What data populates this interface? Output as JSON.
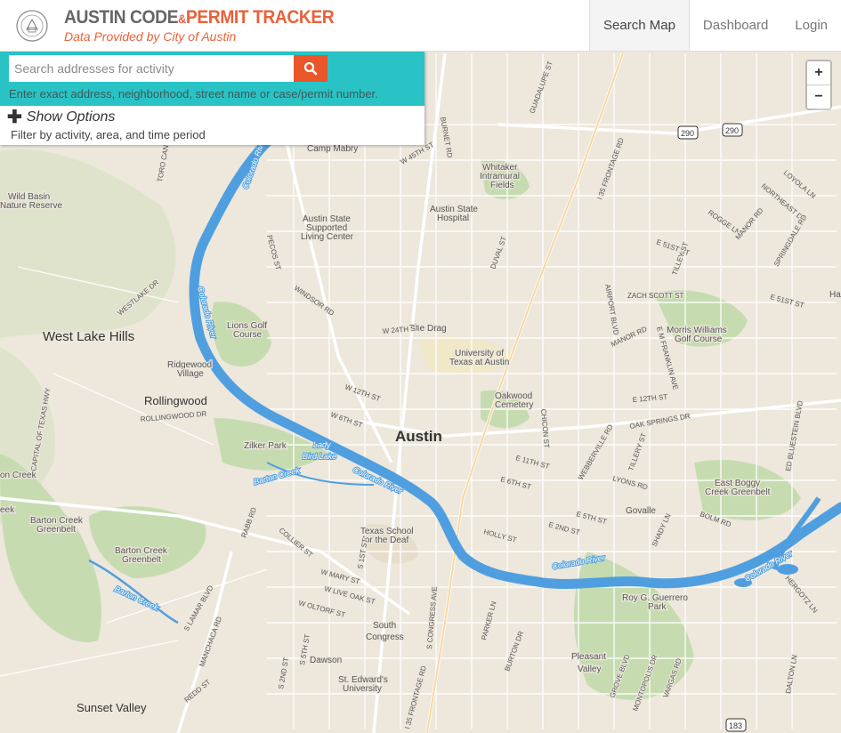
{
  "header": {
    "brand_part1": "AUSTIN CODE",
    "brand_amp": "&",
    "brand_part2": "PERMIT",
    "brand_part3": "TRACKER",
    "subtitle": "Data Provided by City of Austin",
    "nav": [
      "Search Map",
      "Dashboard",
      "Login"
    ]
  },
  "search": {
    "placeholder": "Search addresses for activity",
    "hint": "Enter exact address, neighborhood, street name or case/permit number.",
    "show_options": "Show Options",
    "options_sub": "Filter by activity, area, and time period"
  },
  "zoom": {
    "in": "+",
    "out": "−"
  },
  "colors": {
    "accent_teal": "#29c3c5",
    "accent_orange": "#e8562a",
    "water": "#4f9fe0",
    "park": "#c6dcb0",
    "land": "#ede7dc"
  },
  "map": {
    "cities": [
      {
        "name": "Austin"
      },
      {
        "name": "West Lake Hills"
      },
      {
        "name": "Rollingwood"
      },
      {
        "name": "Sunset Valley"
      }
    ],
    "places": [
      "Camp Mabry",
      "Whitaker",
      "Intramural",
      "Fields",
      "Wild Basin",
      "Nature Reserve",
      "Austin State",
      "Hospital",
      "Austin State",
      "Supported",
      "Living Center",
      "Lions Golf",
      "Course",
      "The Drag",
      "University of",
      "Texas at Austin",
      "Ridgewood",
      "Village",
      "Oakwood",
      "Cemetery",
      "Zilker Park",
      "Morris Williams",
      "Golf Course",
      "East Boggy",
      "Creek Greenbelt",
      "Govalle",
      "Barton Creek",
      "Greenbelt",
      "Barton Creek",
      "Greenbelt",
      "Texas School",
      "for the Deaf",
      "South",
      "Congress",
      "Dawson",
      "St. Edward's",
      "University",
      "Roy G. Guerrero",
      "Park",
      "Pleasant",
      "Valley",
      "on Creek",
      "eek",
      "Ha"
    ],
    "streets": [
      "GUADALUPE ST",
      "BURNET RD",
      "W 45TH ST",
      "I 35 FRONTAGE RD",
      "LOYOLA LN",
      "NORTHEAST DR",
      "ROGGE LN",
      "MANOR RD",
      "E 51ST ST",
      "TILLEY ST",
      "SPRINGDALE RD",
      "ZACH SCOTT ST",
      "E 51ST ST",
      "AIRPORT BLVD",
      "MANOR RD",
      "E M FRANKLIN AVE",
      "DUVAL ST",
      "PECOS ST",
      "WINDSOR RD",
      "WESTLAKE DR",
      "W 24TH ST",
      "W 12TH ST",
      "W 6TH ST",
      "E 11TH ST",
      "E 6TH ST",
      "E 12TH ST",
      "CHICON ST",
      "OAK SPRINGS DR",
      "WEBBERVILLE RD",
      "TILLERY ST",
      "LYONS RD",
      "BOLM RD",
      "E 5TH ST",
      "E 2ND ST",
      "HOLLY ST",
      "SHADY LN",
      "ED BLUESTEIN BLVD",
      "HERGOTZ LN",
      "ROLLINGWOOD DR",
      "CAPITAL OF TEXAS HWY",
      "RABB RD",
      "COLLIER ST",
      "S 1ST ST",
      "W MARY ST",
      "W LIVE OAK ST",
      "W OLTORF ST",
      "S LAMAR BLVD",
      "MANCHACA RD",
      "S 5TH ST",
      "S 2ND ST",
      "REDD ST",
      "PARKER LN",
      "BURTON DR",
      "GROVE BLVD",
      "MONTOPOLIS DR",
      "VARGAS RD",
      "DALTON LN",
      "S CONGRESS AVE",
      "I 35 FRONTAGE RD",
      "TORO CANYON"
    ],
    "water": [
      "Colorado River",
      "Colorado River",
      "Lady",
      "Bird Lake",
      "Colorado River",
      "Barton Creek",
      "Barton Creek",
      "Colorado River",
      "Colorado River"
    ],
    "shields": [
      "290",
      "290",
      "183"
    ]
  }
}
